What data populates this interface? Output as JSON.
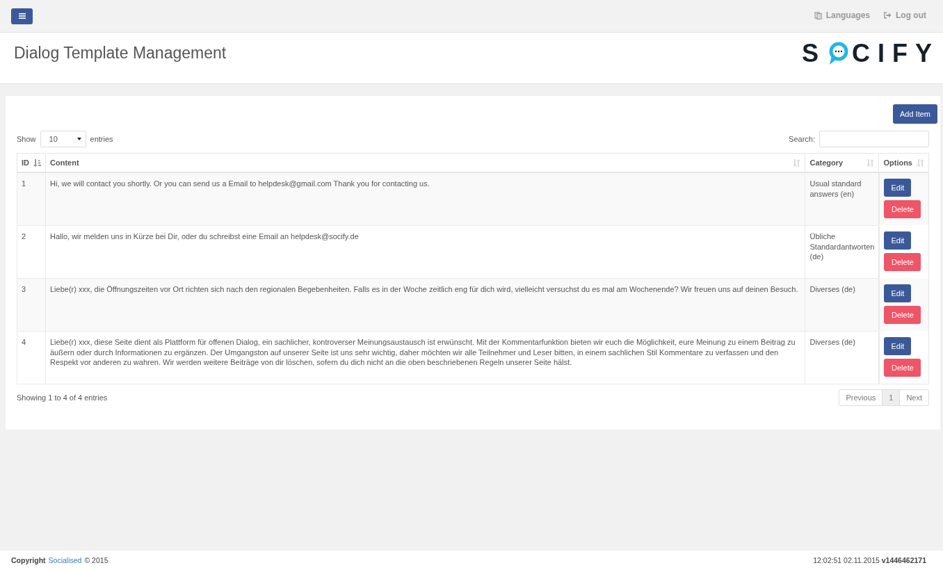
{
  "topbar": {
    "links": [
      {
        "kind": "languages",
        "label": "Languages"
      },
      {
        "kind": "logout",
        "label": "Log out"
      }
    ]
  },
  "header": {
    "title": "Dialog Template Management",
    "logo": {
      "before": "S",
      "after": "CIFY"
    }
  },
  "panel": {
    "add_button": "Add Item",
    "length": {
      "before": "Show",
      "value": "10",
      "after": "entries"
    },
    "search": {
      "label": "Search:"
    },
    "table": {
      "columns": [
        {
          "label": "ID",
          "sorted": true
        },
        {
          "label": "Content",
          "sorted": false
        },
        {
          "label": "Category",
          "sorted": false
        },
        {
          "label": "Options",
          "sorted": false
        }
      ],
      "rows": [
        {
          "id": "1",
          "content": "Hi, we will contact you shortly. Or you can send us a Email to helpdesk@gmail.com Thank you for contacting us.",
          "category": "Usual standard answers (en)",
          "edit": "Edit",
          "delete": "Delete"
        },
        {
          "id": "2",
          "content": "Hallo, wir melden uns in Kürze bei Dir, oder du schreibst eine Email an helpdesk@socify.de",
          "category": "Übliche Standardantworten (de)",
          "edit": "Edit",
          "delete": "Delete"
        },
        {
          "id": "3",
          "content": "Liebe(r) xxx, die Öffnungszeiten vor Ort richten sich nach den regionalen Begebenheiten. Falls es in der Woche zeitlich eng für dich wird, vielleicht versuchst du es mal am Wochenende? Wir freuen uns auf deinen Besuch.",
          "category": "Diverses (de)",
          "edit": "Edit",
          "delete": "Delete"
        },
        {
          "id": "4",
          "content": "Liebe(r) xxx, diese Seite dient als Plattform für offenen Dialog, ein sachlicher, kontroverser Meinungsaustausch ist erwünscht. Mit der Kommentarfunktion bieten wir euch die Möglichkeit, eure Meinung zu einem Beitrag zu äußern oder durch Informationen zu ergänzen. Der Umgangston auf unserer Seite ist uns sehr wichtig, daher möchten wir alle Teilnehmer und Leser bitten, in einem sachlichen Stil Kommentare zu verfassen und den Respekt vor anderen zu wahren. Wir werden weitere Beiträge von dir löschen, sofern du dich nicht an die oben beschriebenen Regeln unserer Seite hälst.",
          "category": "Diverses (de)",
          "edit": "Edit",
          "delete": "Delete"
        }
      ]
    },
    "info": "Showing 1 to 4 of 4 entries",
    "pagination": [
      {
        "label": "Previous",
        "selected": false
      },
      {
        "label": "1",
        "selected": true
      },
      {
        "label": "Next",
        "selected": false
      }
    ]
  },
  "footer": {
    "copyright": "**Copyright**",
    "link": "Socialised",
    "year": "© 2015",
    "version": "12:02:51 02.11.2015 **v1446462171**"
  }
}
